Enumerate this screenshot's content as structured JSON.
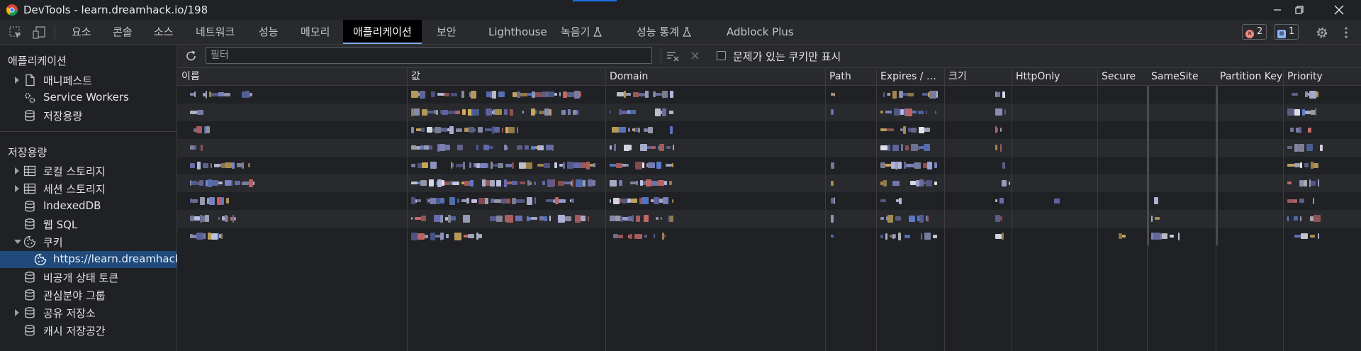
{
  "window": {
    "title": "DevTools - learn.dreamhack.io/198",
    "buttons": [
      "minimize",
      "maximize",
      "close"
    ]
  },
  "toolbar_tabs": {
    "inspect_icon": "inspect-element-icon",
    "device_icon": "device-toolbar-icon",
    "tabs": [
      {
        "label": "요소",
        "active": false
      },
      {
        "label": "콘솔",
        "active": false
      },
      {
        "label": "소스",
        "active": false
      },
      {
        "label": "네트워크",
        "active": false
      },
      {
        "label": "성능",
        "active": false
      },
      {
        "label": "메모리",
        "active": false
      },
      {
        "label": "애플리케이션",
        "active": true
      },
      {
        "label": "보안",
        "active": false
      },
      {
        "label": "Lighthouse",
        "active": false
      },
      {
        "label": "녹음기",
        "active": false,
        "experimental": true
      },
      {
        "label": "성능 통계",
        "active": false,
        "experimental": true
      },
      {
        "label": "Adblock Plus",
        "active": false
      }
    ],
    "errors_count": "2",
    "messages_count": "1",
    "error_color": "#f28b82",
    "message_color": "#8ab4f8"
  },
  "sidebar": {
    "app_heading": "애플리케이션",
    "app_items": [
      {
        "label": "매니페스트",
        "icon": "document-icon",
        "expandable": true
      },
      {
        "label": "Service Workers",
        "icon": "gears-icon",
        "expandable": false
      },
      {
        "label": "저장용량",
        "icon": "database-icon",
        "expandable": false
      }
    ],
    "storage_heading": "저장용량",
    "storage_items": [
      {
        "label": "로컬 스토리지",
        "icon": "table-icon",
        "expandable": true
      },
      {
        "label": "세션 스토리지",
        "icon": "table-icon",
        "expandable": true
      },
      {
        "label": "IndexedDB",
        "icon": "database-icon",
        "expandable": false
      },
      {
        "label": "웹 SQL",
        "icon": "database-icon",
        "expandable": false
      },
      {
        "label": "쿠키",
        "icon": "cookie-icon",
        "expandable": true,
        "expanded": true
      },
      {
        "label": "https://learn.dreamhack.io",
        "icon": "cookie-icon",
        "selected": true,
        "child": true
      },
      {
        "label": "비공개 상태 토큰",
        "icon": "database-icon",
        "expandable": false
      },
      {
        "label": "관심분야 그룹",
        "icon": "database-icon",
        "expandable": false
      },
      {
        "label": "공유 저장소",
        "icon": "database-icon",
        "expandable": true
      },
      {
        "label": "캐시 저장공간",
        "icon": "database-icon",
        "expandable": false
      }
    ]
  },
  "cookie_toolbar": {
    "refresh_icon": "refresh-icon",
    "filter_placeholder": "필터",
    "filter_value": "",
    "clear_filtered_icon": "clear-filtered-icon",
    "delete_icon": "close-icon",
    "only_issues_label": "문제가 있는 쿠키만 표시",
    "only_issues_checked": false
  },
  "cookie_table": {
    "columns": [
      "이름",
      "값",
      "Domain",
      "Path",
      "Expires / M...",
      "크기",
      "HttpOnly",
      "Secure",
      "SameSite",
      "Partition Key",
      "Priority"
    ],
    "row_count": 9,
    "values_redacted": true
  },
  "colors": {
    "background": "#202124",
    "panel": "#292a2d",
    "selection": "#1f4a7a",
    "active_tab_underline": "#7cacf8",
    "border": "#3c3c3c"
  }
}
